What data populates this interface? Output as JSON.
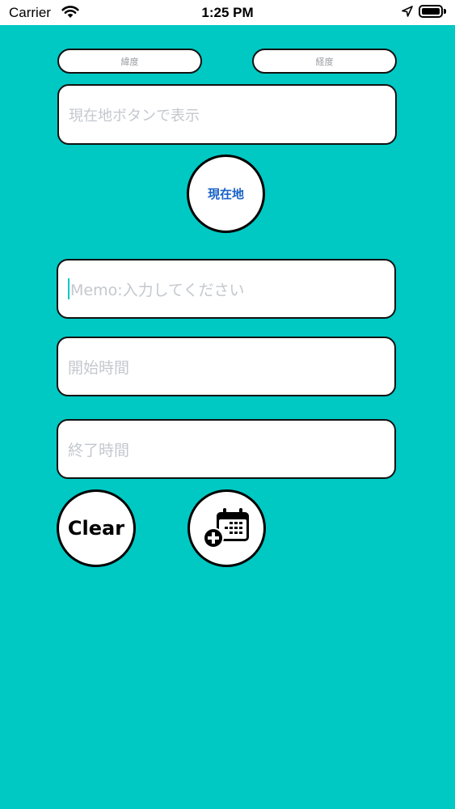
{
  "status_bar": {
    "carrier": "Carrier",
    "time": "1:25 PM"
  },
  "location": {
    "latitude_placeholder": "緯度",
    "longitude_placeholder": "経度",
    "address_placeholder": "現在地ボタンで表示",
    "current_location_button": "現在地"
  },
  "form": {
    "memo_placeholder": "Memo:入力してください",
    "start_time_placeholder": "開始時間",
    "end_time_placeholder": "終了時間"
  },
  "actions": {
    "clear_label": "Clear",
    "add_calendar_icon": "calendar-add-icon"
  },
  "colors": {
    "background": "#00c8c3",
    "accent": "#1a63c7"
  }
}
